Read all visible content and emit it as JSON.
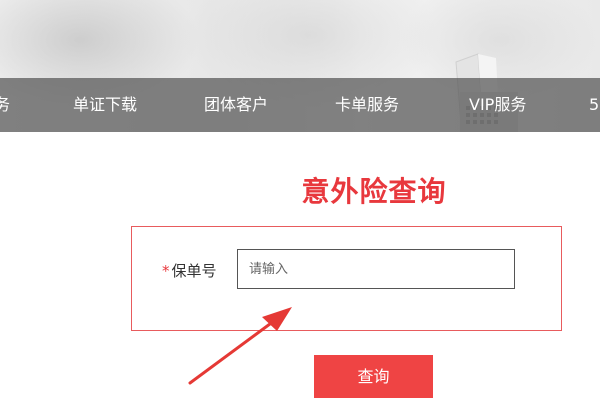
{
  "navbar": {
    "items": [
      {
        "label": "务"
      },
      {
        "label": "单证下载"
      },
      {
        "label": "团体客户"
      },
      {
        "label": "卡单服务"
      },
      {
        "label": "VIP服务"
      },
      {
        "label": "5"
      }
    ]
  },
  "main": {
    "title": "意外险查询",
    "form": {
      "required_mark": "*",
      "policy_label": "保单号",
      "policy_placeholder": "请输入",
      "policy_value": ""
    },
    "query_button_label": "查询"
  },
  "colors": {
    "accent": "#ef4444",
    "title": "#e8383d",
    "nav_background": "#555555",
    "annotation": "#e53935"
  },
  "icons": {
    "annotation_arrow": "arrow-icon"
  }
}
